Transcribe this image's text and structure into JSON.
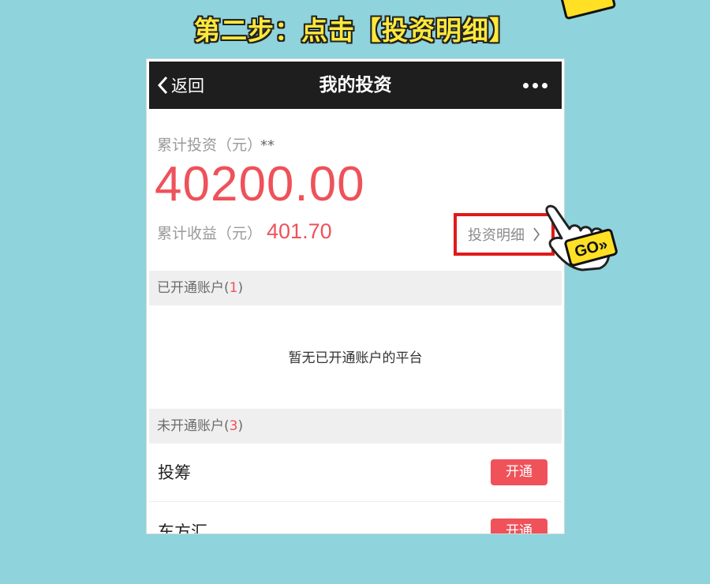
{
  "instruction": "第二步：点击【投资明细】",
  "navbar": {
    "back_label": "返回",
    "title": "我的投资"
  },
  "summary": {
    "cumulative_label": "累计投资（元）",
    "cumulative_mark": "**",
    "cumulative_amount": "40200.00",
    "earnings_label": "累计收益（元）",
    "earnings_value": "401.70",
    "detail_link": "投资明细"
  },
  "opened_section": {
    "label": "已开通账户(",
    "count": "1",
    "close": ")",
    "empty_text": "暂无已开通账户的平台"
  },
  "unopened_section": {
    "label": "未开通账户(",
    "count": "3",
    "close": ")",
    "items": [
      {
        "name": "投筹",
        "button": "开通"
      },
      {
        "name": "东方汇",
        "button": "开通"
      }
    ]
  },
  "pointer_badge": "GO»",
  "colors": {
    "accent_red": "#ee525a",
    "highlight_border": "#e01a1a",
    "background": "#8fd3dc",
    "title_yellow": "#ffe93a"
  }
}
